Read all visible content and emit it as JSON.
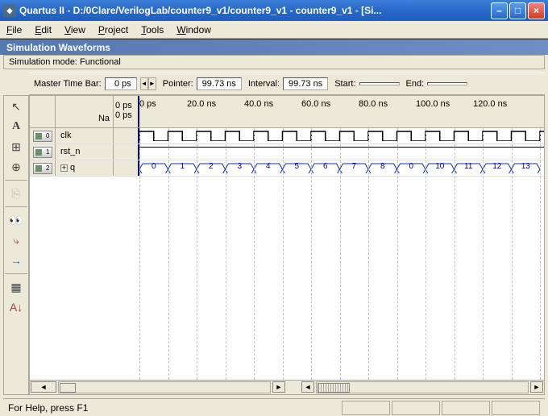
{
  "window": {
    "title": "Quartus II - D:/0Clare/VerilogLab/counter9_v1/counter9_v1 - counter9_v1 - [Si..."
  },
  "menu": {
    "file": "File",
    "edit": "Edit",
    "view": "View",
    "project": "Project",
    "tools": "Tools",
    "window": "Window"
  },
  "panel": {
    "title": "Simulation Waveforms",
    "mode": "Simulation mode: Functional"
  },
  "timebar": {
    "master_label": "Master Time Bar:",
    "master_value": "0 ps",
    "pointer_label": "Pointer:",
    "pointer_value": "99.73 ns",
    "interval_label": "Interval:",
    "interval_value": "99.73 ns",
    "start_label": "Start:",
    "start_value": "",
    "end_label": "End:",
    "end_value": ""
  },
  "ruler": {
    "ticks": [
      "0 ps",
      "20.0 ns",
      "40.0 ns",
      "60.0 ns",
      "80.0 ns",
      "100.0 ns",
      "120.0 ns"
    ],
    "cursor": "0 ps",
    "name_header": "Na"
  },
  "signals": [
    {
      "idx": "0",
      "name": "clk",
      "type": "clock",
      "expandable": false
    },
    {
      "idx": "1",
      "name": "rst_n",
      "type": "high",
      "expandable": false
    },
    {
      "idx": "2",
      "name": "q",
      "type": "bus",
      "expandable": true,
      "values": [
        "0",
        "1",
        "2",
        "3",
        "4",
        "5",
        "6",
        "7",
        "8",
        "0",
        "10",
        "11",
        "12",
        "13"
      ]
    }
  ],
  "chart_data": {
    "type": "table",
    "title": "Simulation Waveforms (Functional)",
    "time_unit": "ns",
    "time_range_ns": [
      0,
      140
    ],
    "clk_period_ns": 10,
    "series": [
      {
        "name": "clk",
        "kind": "clock",
        "period_ns": 10,
        "initial": 0
      },
      {
        "name": "rst_n",
        "kind": "level",
        "value": 1
      },
      {
        "name": "q",
        "kind": "bus",
        "width": 4,
        "transitions_ns": [
          0,
          10,
          20,
          30,
          40,
          50,
          60,
          70,
          80,
          90,
          100,
          110,
          120,
          130
        ],
        "values": [
          0,
          1,
          2,
          3,
          4,
          5,
          6,
          7,
          8,
          0,
          10,
          11,
          12,
          13
        ]
      }
    ]
  },
  "status": {
    "text": "For Help, press F1"
  }
}
